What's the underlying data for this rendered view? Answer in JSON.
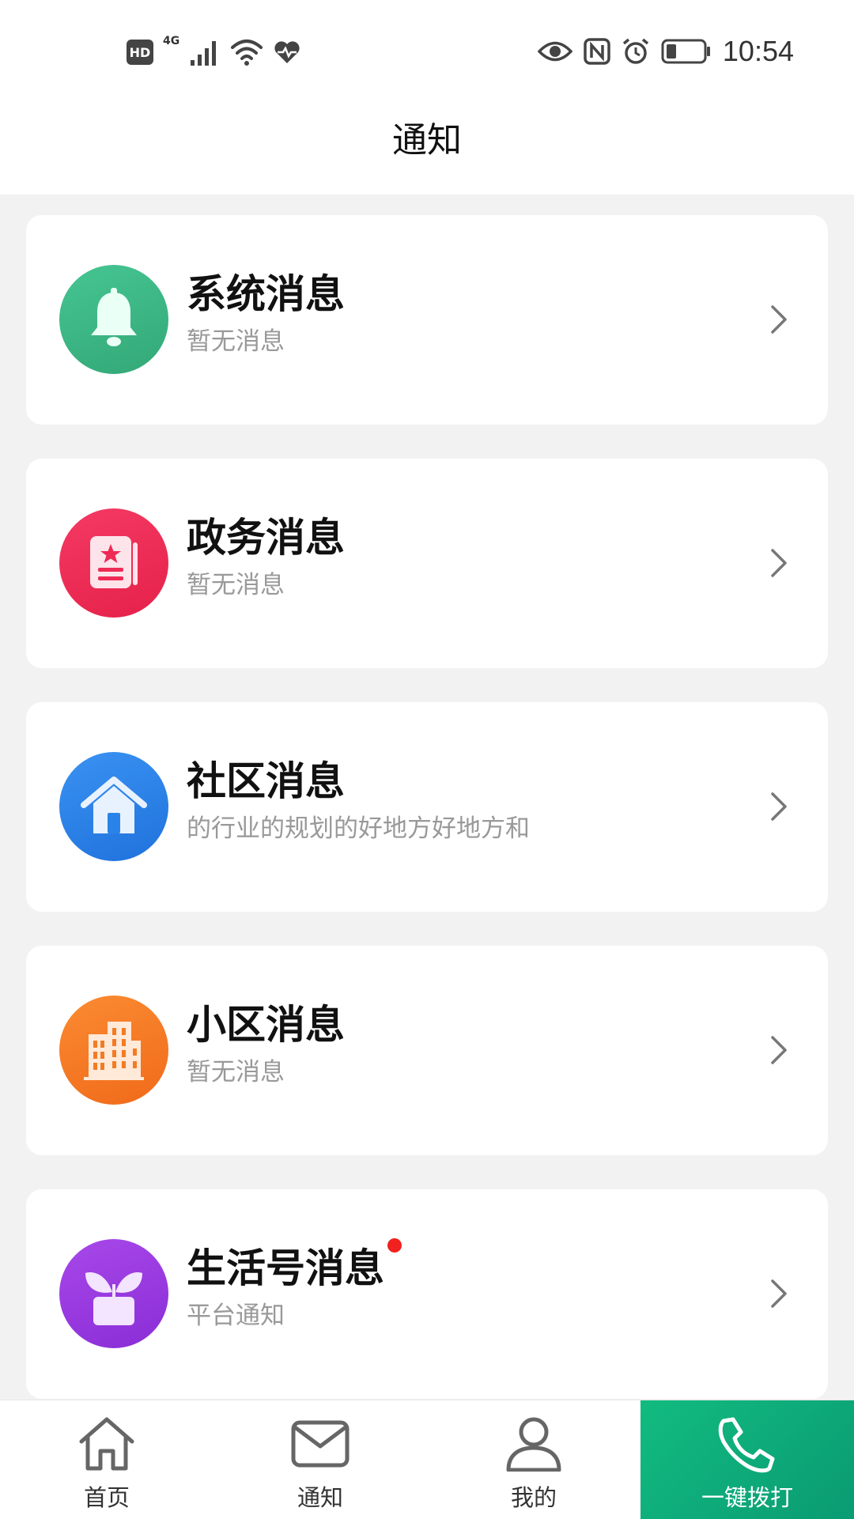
{
  "status_bar": {
    "hd": "HD",
    "network": "4G",
    "time": "10:54"
  },
  "header": {
    "title": "通知"
  },
  "cards": [
    {
      "title": "系统消息",
      "subtitle": "暂无消息",
      "icon": "bell-icon",
      "color": "#3dba86",
      "unread": false
    },
    {
      "title": "政务消息",
      "subtitle": "暂无消息",
      "icon": "document-star-icon",
      "color": "#ee2a55",
      "unread": false
    },
    {
      "title": "社区消息",
      "subtitle": "的行业的规划的好地方好地方和",
      "icon": "house-icon",
      "color": "#2a83e8",
      "unread": false
    },
    {
      "title": "小区消息",
      "subtitle": "暂无消息",
      "icon": "building-icon",
      "color": "#f57b22",
      "unread": false
    },
    {
      "title": "生活号消息",
      "subtitle": "平台通知",
      "icon": "plant-icon",
      "color": "#9a3ae0",
      "unread": true
    }
  ],
  "tabbar": {
    "home": "首页",
    "notice": "通知",
    "mine": "我的",
    "call": "一键拨打"
  },
  "colors": {
    "accent": "#0fad7b",
    "unread_dot": "#f0211e"
  }
}
